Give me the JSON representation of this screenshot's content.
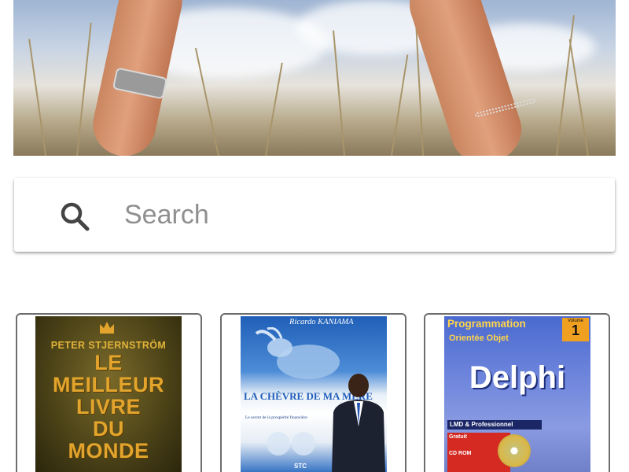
{
  "search": {
    "placeholder": "Search",
    "icon": "search-icon"
  },
  "books": [
    {
      "author": "PETER STJERNSTRÖM",
      "title_lines": [
        "LE",
        "MEILLEUR",
        "LIVRE",
        "DU",
        "MONDE"
      ]
    },
    {
      "author": "Ricardo KANIAMA",
      "title": "LA CHÈVRE DE MA MÈRE",
      "subtitle": "Le secret de la prospérité financière",
      "publisher": "STC"
    },
    {
      "series_line1": "Programmation",
      "series_line2": "Orientée Objet",
      "volume_label": "Volume",
      "volume_number": "1",
      "title": "Delphi",
      "band": "LMD & Professionnel",
      "badge": "Gratuit",
      "media": "CD ROM"
    }
  ]
}
